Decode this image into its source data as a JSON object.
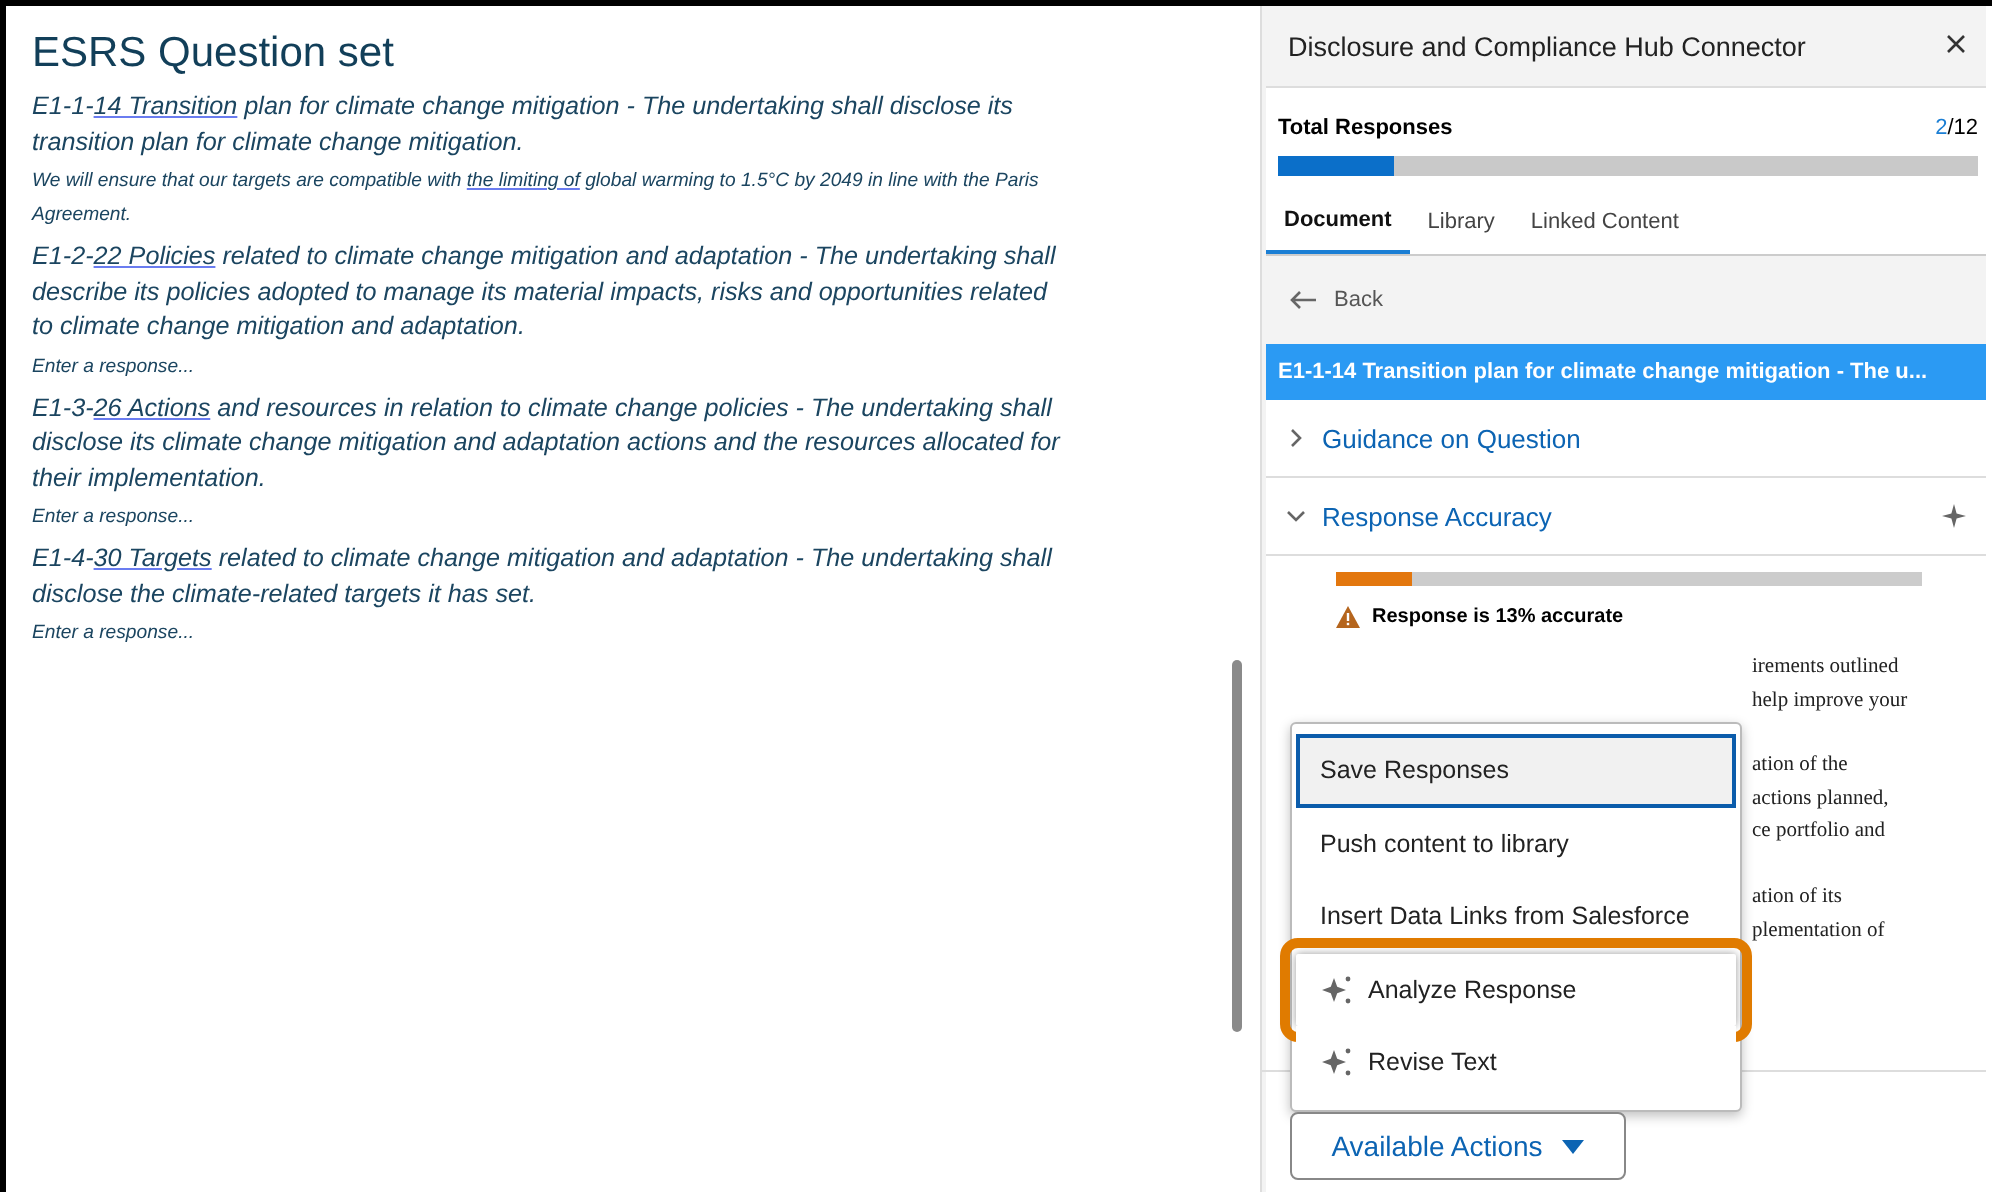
{
  "document": {
    "title": "ESRS Question set",
    "questions": [
      {
        "prefix": "E1-1-",
        "underlined": "14  Transition",
        "rest": " plan for climate change mitigation - The undertaking shall disclose its transition plan for climate change mitigation.",
        "response": {
          "before": "We will ensure that our targets are compatible with ",
          "underlined": "the limiting of",
          "after": " global warming to 1.5°C by 2049 in line with the Paris Agreement."
        }
      },
      {
        "prefix": "E1-2-",
        "underlined": "22  Policies",
        "rest": " related to climate change mitigation and adaptation - The undertaking shall describe its policies adopted to manage its material impacts, risks and opportunities related to climate change mitigation and adaptation.",
        "placeholder": "Enter a response..."
      },
      {
        "prefix": "E1-3-",
        "underlined": "26  Actions",
        "rest": " and resources in relation to climate change policies - The undertaking shall disclose its climate change mitigation and adaptation actions and the resources allocated for their implementation.",
        "placeholder": "Enter a response..."
      },
      {
        "prefix": "E1-4-",
        "underlined": "30  Targets",
        "rest": " related to climate change mitigation and adaptation - The undertaking shall disclose the climate-related targets it has set.",
        "placeholder": "Enter a response..."
      }
    ]
  },
  "panel": {
    "title": "Disclosure and Compliance Hub Connector",
    "progress": {
      "label": "Total Responses",
      "done": "2",
      "total": "/12",
      "level": 0.167
    },
    "tabs": [
      {
        "label": "Document",
        "selected": true
      },
      {
        "label": "Library",
        "selected": false
      },
      {
        "label": "Linked Content",
        "selected": false
      }
    ],
    "back": "Back",
    "question_bar": "E1-1-14  Transition plan for climate change mitigation - The u...",
    "sections": [
      {
        "label": "Guidance on Question",
        "expanded": false
      },
      {
        "label": "Response Accuracy",
        "expanded": true
      }
    ],
    "accuracy": {
      "level": 0.13,
      "message": "Response is 13% accurate"
    },
    "feedback_fragments": [
      "irements outlined",
      "help improve your",
      "ation of the",
      "actions planned,",
      "ce portfolio and",
      "ation of its",
      "plementation of"
    ],
    "menu": [
      {
        "label": "Save Responses",
        "kind": "plain",
        "selected": true,
        "highlighted": false
      },
      {
        "label": "Push content to library",
        "kind": "plain",
        "selected": false,
        "highlighted": false
      },
      {
        "label": "Insert Data Links from Salesforce",
        "kind": "plain",
        "selected": false,
        "highlighted": false
      },
      {
        "label": "Analyze Response",
        "kind": "ai",
        "selected": false,
        "highlighted": true
      },
      {
        "label": "Revise Text",
        "kind": "ai",
        "selected": false,
        "highlighted": false
      }
    ],
    "actions_button": "Available Actions"
  }
}
